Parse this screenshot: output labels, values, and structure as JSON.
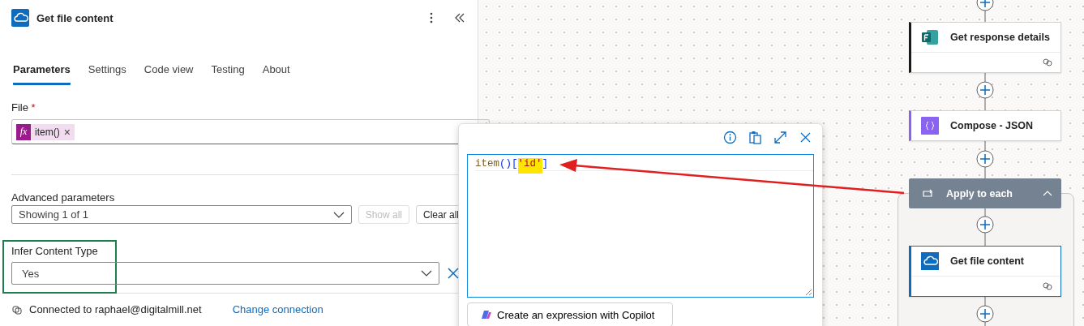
{
  "panel": {
    "title": "Get file content",
    "tabs": [
      {
        "label": "Parameters",
        "selected": true
      },
      {
        "label": "Settings",
        "selected": false
      },
      {
        "label": "Code view",
        "selected": false
      },
      {
        "label": "Testing",
        "selected": false
      },
      {
        "label": "About",
        "selected": false
      }
    ],
    "file_field": {
      "label": "File",
      "required_mark": "*",
      "token": {
        "icon": "fx",
        "text": "item()",
        "remove": "×"
      }
    },
    "advanced": {
      "label": "Advanced parameters",
      "value": "Showing 1 of 1",
      "buttons": [
        {
          "label": "Show all",
          "disabled": true
        },
        {
          "label": "Clear all",
          "disabled": false
        }
      ]
    },
    "infer": {
      "label": "Infer Content Type",
      "value": "Yes"
    },
    "connection": {
      "text": "Connected to raphael@digitalmill.net",
      "link": "Change connection"
    }
  },
  "expression_editor": {
    "tokens": [
      {
        "text": "item",
        "kind": "func",
        "highlighted": false
      },
      {
        "text": "()",
        "kind": "punct",
        "highlighted": false
      },
      {
        "text": "[",
        "kind": "punct",
        "highlighted": false
      },
      {
        "text": "'id'",
        "kind": "string",
        "highlighted": true
      },
      {
        "text": "]",
        "kind": "punct",
        "highlighted": false
      }
    ],
    "copilot_button": "Create an expression with Copilot"
  },
  "flow": {
    "nodes": [
      {
        "kind": "action",
        "title": "Get response details",
        "footer": true,
        "selected": false,
        "color": "#1a1a1a"
      },
      {
        "kind": "action",
        "title": "Compose - JSON",
        "footer": false,
        "selected": false,
        "color": "#8a63f0"
      },
      {
        "kind": "scope",
        "title": "Apply to each",
        "expanded": true
      },
      {
        "kind": "action",
        "title": "Get file content",
        "footer": true,
        "selected": true,
        "color": "#0f6cbd"
      }
    ]
  }
}
